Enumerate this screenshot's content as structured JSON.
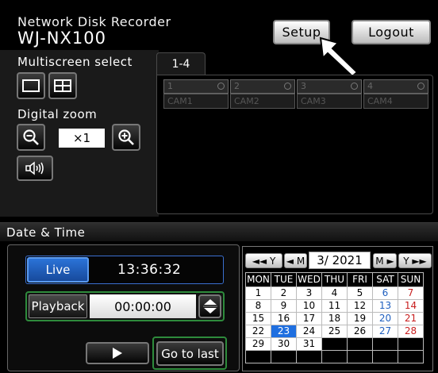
{
  "header": {
    "product": "Network Disk Recorder",
    "model": "WJ-NX100",
    "setup_label": "Setup",
    "logout_label": "Logout"
  },
  "left_panel": {
    "multiscreen_label": "Multiscreen select",
    "digital_zoom_label": "Digital zoom",
    "zoom_value": "×1"
  },
  "cameras": {
    "tab_label": "1-4",
    "items": [
      {
        "number": "1",
        "name": "CAM1"
      },
      {
        "number": "2",
        "name": "CAM2"
      },
      {
        "number": "3",
        "name": "CAM3"
      },
      {
        "number": "4",
        "name": "CAM4"
      }
    ]
  },
  "datetime": {
    "section_label": "Date & Time",
    "live_label": "Live",
    "live_time": "13:36:32",
    "playback_label": "Playback",
    "playback_time": "00:00:00",
    "go_to_last_label": "Go to last"
  },
  "calendar": {
    "prev_year": "◄◄ Y",
    "prev_month": "◄ M",
    "month_year": "3/ 2021",
    "next_month": "M ►",
    "next_year": "Y ►►",
    "weekdays": [
      "MON",
      "TUE",
      "WED",
      "THU",
      "FRI",
      "SAT",
      "SUN"
    ],
    "selected_day": "23",
    "weeks": [
      [
        "1",
        "2",
        "3",
        "4",
        "5",
        "6",
        "7"
      ],
      [
        "8",
        "9",
        "10",
        "11",
        "12",
        "13",
        "14"
      ],
      [
        "15",
        "16",
        "17",
        "18",
        "19",
        "20",
        "21"
      ],
      [
        "22",
        "23",
        "24",
        "25",
        "26",
        "27",
        "28"
      ],
      [
        "29",
        "30",
        "31",
        "",
        "",
        "",
        ""
      ],
      [
        "",
        "",
        "",
        "",
        "",
        "",
        ""
      ]
    ],
    "colors": {
      "saturday": "#1f5fbf",
      "sunday": "#c81e1e",
      "selected_bg": "#1f6fe0",
      "weekday_bg": "#ffffff"
    }
  }
}
